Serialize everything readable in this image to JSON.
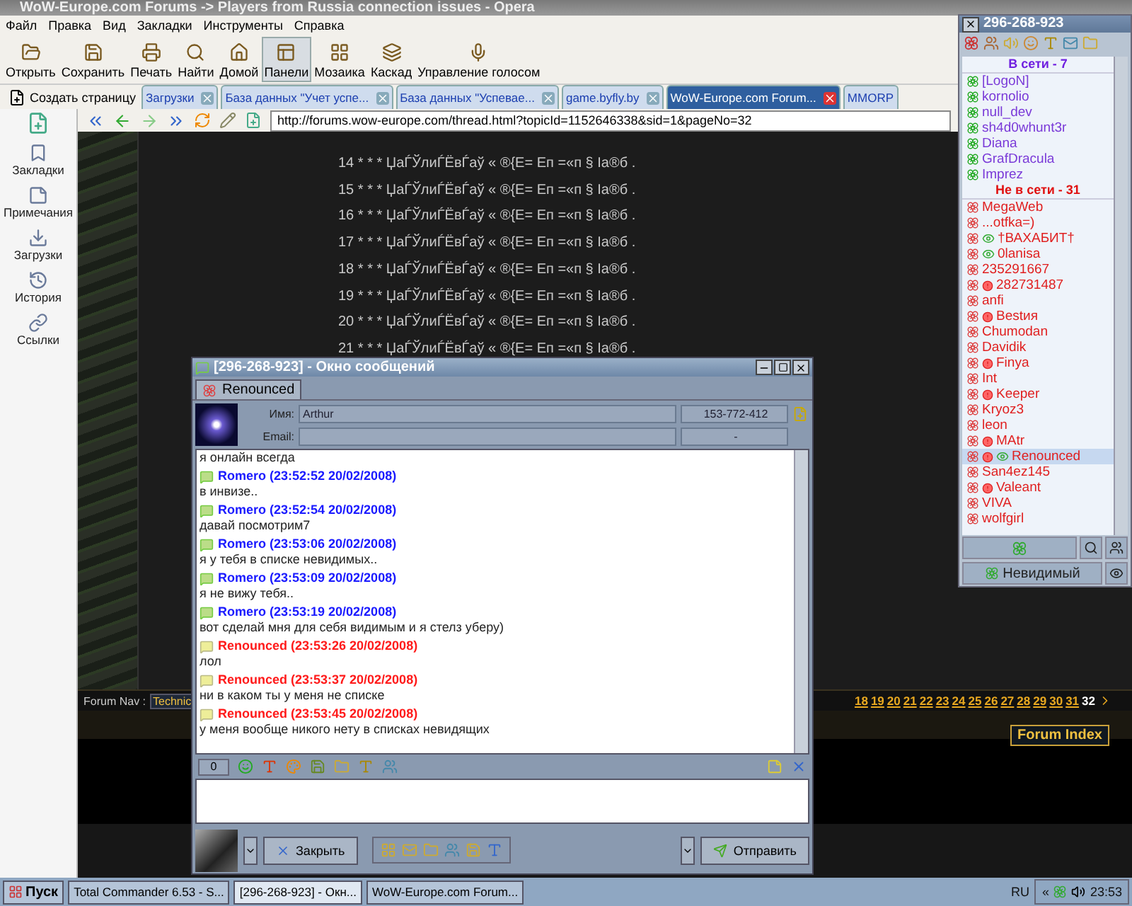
{
  "browser": {
    "title": "WoW-Europe.com Forums -> Players from Russia connection issues - Opera",
    "menu": [
      "Файл",
      "Правка",
      "Вид",
      "Закладки",
      "Инструменты",
      "Справка"
    ],
    "toolbar": [
      {
        "kind": "open",
        "label": "Открыть",
        "selected": false
      },
      {
        "kind": "save",
        "label": "Сохранить",
        "selected": false
      },
      {
        "kind": "print",
        "label": "Печать",
        "selected": false
      },
      {
        "kind": "find",
        "label": "Найти",
        "selected": false
      },
      {
        "kind": "home",
        "label": "Домой",
        "selected": false
      },
      {
        "kind": "panels",
        "label": "Панели",
        "selected": true
      },
      {
        "kind": "tile",
        "label": "Мозаика",
        "selected": false
      },
      {
        "kind": "cascade",
        "label": "Каскад",
        "selected": false
      },
      {
        "kind": "voice",
        "label": "Управление голосом",
        "selected": false
      }
    ],
    "new_page": "Создать страницу",
    "tabs": [
      {
        "label": "Загрузки",
        "selected": false
      },
      {
        "label": "База данных \"Учет успе...",
        "selected": false
      },
      {
        "label": "База данных \"Успевае...",
        "selected": false
      },
      {
        "label": "game.byfly.by",
        "selected": false
      },
      {
        "label": "WoW-Europe.com Forum...",
        "selected": true
      },
      {
        "label": "MMORP",
        "selected": false
      }
    ],
    "address": "http://forums.wow-europe.com/thread.html?topicId=1152646338&sid=1&pageNo=32",
    "side_panel": [
      {
        "kind": "bookmarks",
        "label": "Закладки"
      },
      {
        "kind": "notes",
        "label": "Примечания"
      },
      {
        "kind": "downloads",
        "label": "Загрузки"
      },
      {
        "kind": "history",
        "label": "История"
      },
      {
        "kind": "links",
        "label": "Ссылки"
      }
    ],
    "forum": {
      "lines": [
        "14 * * * ЏаЃЎлиЃЁвЃаў « ®{Е= Еп =«п § Іа®б .",
        "15 * * * ЏаЃЎлиЃЁвЃаў « ®{Е= Еп =«п § Іа®б .",
        "16 * * * ЏаЃЎлиЃЁвЃаў « ®{Е= Еп =«п § Іа®б .",
        "17 * * * ЏаЃЎлиЃЁвЃаў « ®{Е= Еп =«п § Іа®б .",
        "18 * * * ЏаЃЎлиЃЁвЃаў « ®{Е= Еп =«п § Іа®б .",
        "19 * * * ЏаЃЎлиЃЁвЃаў « ®{Е= Еп =«п § Іа®б .",
        "20 * * * ЏаЃЎлиЃЁвЃаў « ®{Е= Еп =«п § Іа®б .",
        "21 * * * ЏаЃЎлиЃЁвЃаў « ®{Е= Еп =«п § Іа®б ."
      ],
      "nav_label": "Forum Nav :",
      "nav_select": "Technic",
      "pages": [
        {
          "label": "18",
          "selected": false
        },
        {
          "label": "19",
          "selected": false
        },
        {
          "label": "20",
          "selected": false
        },
        {
          "label": "21",
          "selected": false
        },
        {
          "label": "22",
          "selected": false
        },
        {
          "label": "23",
          "selected": false
        },
        {
          "label": "24",
          "selected": false
        },
        {
          "label": "25",
          "selected": false
        },
        {
          "label": "26",
          "selected": false
        },
        {
          "label": "27",
          "selected": false
        },
        {
          "label": "28",
          "selected": false
        },
        {
          "label": "29",
          "selected": false
        },
        {
          "label": "30",
          "selected": false
        },
        {
          "label": "31",
          "selected": false
        },
        {
          "label": "32",
          "selected": true
        }
      ],
      "forum_index": "Forum Index"
    }
  },
  "icq": {
    "title": "296-268-923",
    "online_header": "В сети - 7",
    "online": [
      {
        "name": "[LogoN]",
        "selected": false
      },
      {
        "name": "kornolio",
        "selected": false
      },
      {
        "name": "null_dev",
        "selected": false
      },
      {
        "name": "sh4d0whunt3r",
        "selected": false
      },
      {
        "name": "Diana",
        "selected": false
      },
      {
        "name": "GrafDracula",
        "selected": false
      },
      {
        "name": "Imprez",
        "selected": false
      }
    ],
    "offline_header": "Не в сети - 31",
    "offline": [
      {
        "name": "MegaWeb",
        "alert": false,
        "eye": false,
        "selected": false
      },
      {
        "name": "...otfka=)",
        "alert": false,
        "eye": false,
        "selected": false
      },
      {
        "name": "†ВАХАБИТ†",
        "alert": false,
        "eye": true,
        "selected": false
      },
      {
        "name": "0lanisa",
        "alert": false,
        "eye": true,
        "selected": false
      },
      {
        "name": "235291667",
        "alert": false,
        "eye": false,
        "selected": false
      },
      {
        "name": "282731487",
        "alert": true,
        "eye": false,
        "selected": false
      },
      {
        "name": "anfi",
        "alert": false,
        "eye": false,
        "selected": false
      },
      {
        "name": "Bestия",
        "alert": true,
        "eye": false,
        "selected": false
      },
      {
        "name": "Chumodan",
        "alert": false,
        "eye": false,
        "selected": false
      },
      {
        "name": "Davidik",
        "alert": false,
        "eye": false,
        "selected": false
      },
      {
        "name": "Finya",
        "alert": true,
        "eye": false,
        "selected": false
      },
      {
        "name": "Int",
        "alert": false,
        "eye": false,
        "selected": false
      },
      {
        "name": "Keeper",
        "alert": true,
        "eye": false,
        "selected": false
      },
      {
        "name": "Kryoz3",
        "alert": false,
        "eye": false,
        "selected": false
      },
      {
        "name": "leon",
        "alert": false,
        "eye": false,
        "selected": false
      },
      {
        "name": "MAtr",
        "alert": true,
        "eye": false,
        "selected": false
      },
      {
        "name": "Renounced",
        "alert": true,
        "eye": true,
        "selected": true
      },
      {
        "name": "San4ez145",
        "alert": false,
        "eye": false,
        "selected": false
      },
      {
        "name": "Valeant",
        "alert": true,
        "eye": false,
        "selected": false
      },
      {
        "name": "VIVA",
        "alert": false,
        "eye": false,
        "selected": false
      },
      {
        "name": "wolfgirl",
        "alert": false,
        "eye": false,
        "selected": false
      }
    ],
    "status": "Невидимый"
  },
  "chat": {
    "title": "[296-268-923] - Окно сообщений",
    "tab": "Renounced",
    "name_label": "Имя:",
    "name": "Arthur",
    "uin": "153-772-412",
    "email_label": "Email:",
    "email": "-",
    "top_line": "я онлайн всегда",
    "messages": [
      {
        "kind": "outgoing",
        "header": "Romero (23:52:52 20/02/2008)",
        "text": "в инвизе.."
      },
      {
        "kind": "outgoing",
        "header": "Romero (23:52:54 20/02/2008)",
        "text": "давай посмотрим7"
      },
      {
        "kind": "outgoing",
        "header": "Romero (23:53:06 20/02/2008)",
        "text": "я у тебя в списке невидимых.."
      },
      {
        "kind": "outgoing",
        "header": "Romero (23:53:09 20/02/2008)",
        "text": "я не вижу тебя.."
      },
      {
        "kind": "outgoing",
        "header": "Romero (23:53:19 20/02/2008)",
        "text": "вот сделай мня для себя видимым и я стелз уберу)"
      },
      {
        "kind": "incoming",
        "header": "Renounced (23:53:26 20/02/2008)",
        "text": "лол"
      },
      {
        "kind": "incoming",
        "header": "Renounced (23:53:37 20/02/2008)",
        "text": "ни в каком ты у меня не списке"
      },
      {
        "kind": "incoming",
        "header": "Renounced (23:53:45 20/02/2008)",
        "text": "у меня вообще никого нету в списках невидящих"
      }
    ],
    "counter": "0",
    "close": "Закрыть",
    "send": "Отправить"
  },
  "taskbar": {
    "start": "Пуск",
    "tasks": [
      {
        "label": "Total Commander 6.53 - S...",
        "selected": false
      },
      {
        "label": "[296-268-923] - Окн...",
        "selected": true
      },
      {
        "label": "WoW-Europe.com Forum...",
        "selected": false
      }
    ],
    "lang": "RU",
    "tray_toggle": "«",
    "clock": "23:53"
  }
}
